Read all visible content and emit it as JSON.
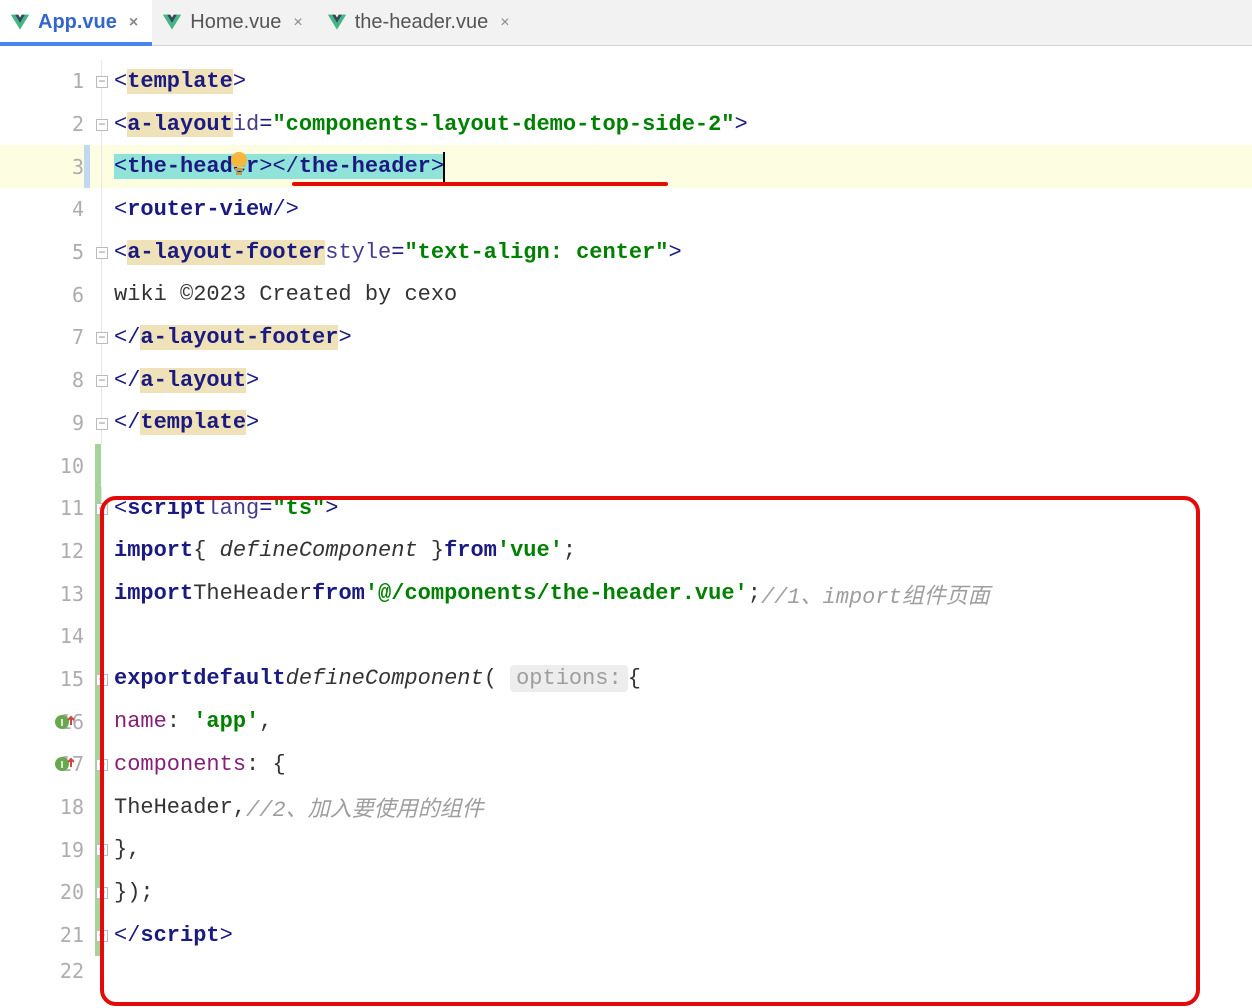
{
  "tabs": [
    {
      "label": "App.vue",
      "active": true
    },
    {
      "label": "Home.vue",
      "active": false
    },
    {
      "label": "the-header.vue",
      "active": false
    }
  ],
  "line_numbers": [
    "1",
    "2",
    "3",
    "4",
    "5",
    "6",
    "7",
    "8",
    "9",
    "10",
    "11",
    "12",
    "13",
    "14",
    "15",
    "16",
    "17",
    "18",
    "19",
    "20",
    "21",
    "22"
  ],
  "code": {
    "l1": {
      "tag": "template"
    },
    "l2": {
      "tag": "a-layout",
      "attr": "id",
      "val": "\"components-layout-demo-top-side-2\""
    },
    "l3": {
      "open": "the-header",
      "close": "the-header"
    },
    "l4": {
      "tag": "router-view"
    },
    "l5": {
      "tag": "a-layout-footer",
      "attr": "style",
      "val": "\"text-align: center\""
    },
    "l6": {
      "text": "wiki ©2023 Created by cexo"
    },
    "l7": {
      "tag": "a-layout-footer"
    },
    "l8": {
      "tag": "a-layout"
    },
    "l9": {
      "tag": "template"
    },
    "l11": {
      "tag": "script",
      "attr": "lang",
      "val": "\"ts\""
    },
    "l12": {
      "kw1": "import",
      "braces": "{ ",
      "ident": "defineComponent",
      "braces2": " }",
      "kw2": "from",
      "str": "'vue'",
      "semi": ";"
    },
    "l13": {
      "kw1": "import",
      "ident": "TheHeader",
      "kw2": "from",
      "str": "'@/components/the-header.vue'",
      "semi": ";",
      "comment": "//1、import组件页面"
    },
    "l15": {
      "kw1": "export",
      "kw2": "default",
      "ident": "defineComponent",
      "hint": "options:",
      "brace": "{"
    },
    "l16": {
      "key": "name",
      "val": "'app'",
      "comma": ","
    },
    "l17": {
      "key": "components",
      "brace": "{"
    },
    "l18": {
      "ident": "TheHeader",
      "comma": ",",
      "comment": "//2、加入要使用的组件"
    },
    "l19": {
      "brace": "}",
      "comma": ","
    },
    "l20": {
      "brace": "});"
    },
    "l21": {
      "tag": "script"
    }
  }
}
